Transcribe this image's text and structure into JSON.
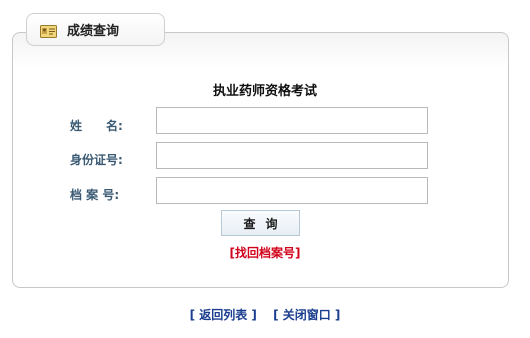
{
  "tab": {
    "title": "成绩查询",
    "icon": "id-card-icon"
  },
  "form": {
    "title": "执业药师资格考试",
    "fields": [
      {
        "label": "姓　　名:",
        "value": "",
        "placeholder": ""
      },
      {
        "label": "身份证号:",
        "value": "",
        "placeholder": ""
      },
      {
        "label": "档 案 号:",
        "value": "",
        "placeholder": ""
      }
    ],
    "submit_label": "查询",
    "find_link": "[找回档案号]"
  },
  "footer": {
    "back_link": "[ 返回列表 ]",
    "close_link": "[ 关闭窗口 ]"
  }
}
